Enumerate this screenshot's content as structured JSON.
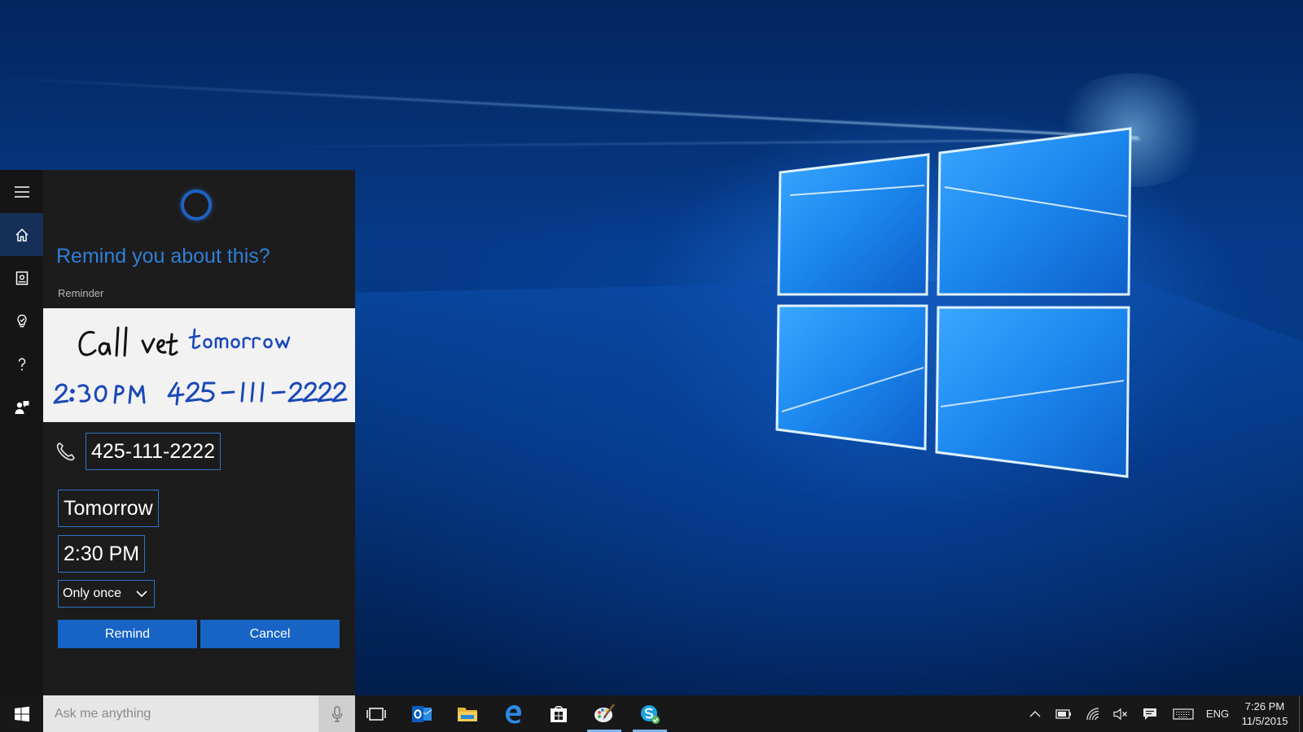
{
  "cortana": {
    "prompt": "Remind you about this?",
    "subhead": "Reminder",
    "ink_line1": "Call vet tomorrow",
    "ink_line2": "2:30 PM 425-111-2222",
    "phone": "425-111-2222",
    "date": "Tomorrow",
    "time": "2:30 PM",
    "repeat": "Only once",
    "remind_label": "Remind",
    "cancel_label": "Cancel",
    "rail_icons": [
      "hamburger-menu-icon",
      "home-icon",
      "notebook-icon",
      "lightbulb-icon",
      "help-icon",
      "feedback-icon"
    ]
  },
  "taskbar": {
    "search_placeholder": "Ask me anything",
    "apps": [
      "task-view-icon",
      "outlook-icon",
      "file-explorer-icon",
      "edge-icon",
      "store-icon",
      "paint-icon",
      "skype-icon"
    ],
    "language": "ENG",
    "time": "7:26 PM",
    "date": "11/5/2015"
  },
  "colors": {
    "accent": "#1764c4",
    "prompt": "#2f7fd8",
    "ink_black": "#111111",
    "ink_blue": "#1a48b8"
  }
}
